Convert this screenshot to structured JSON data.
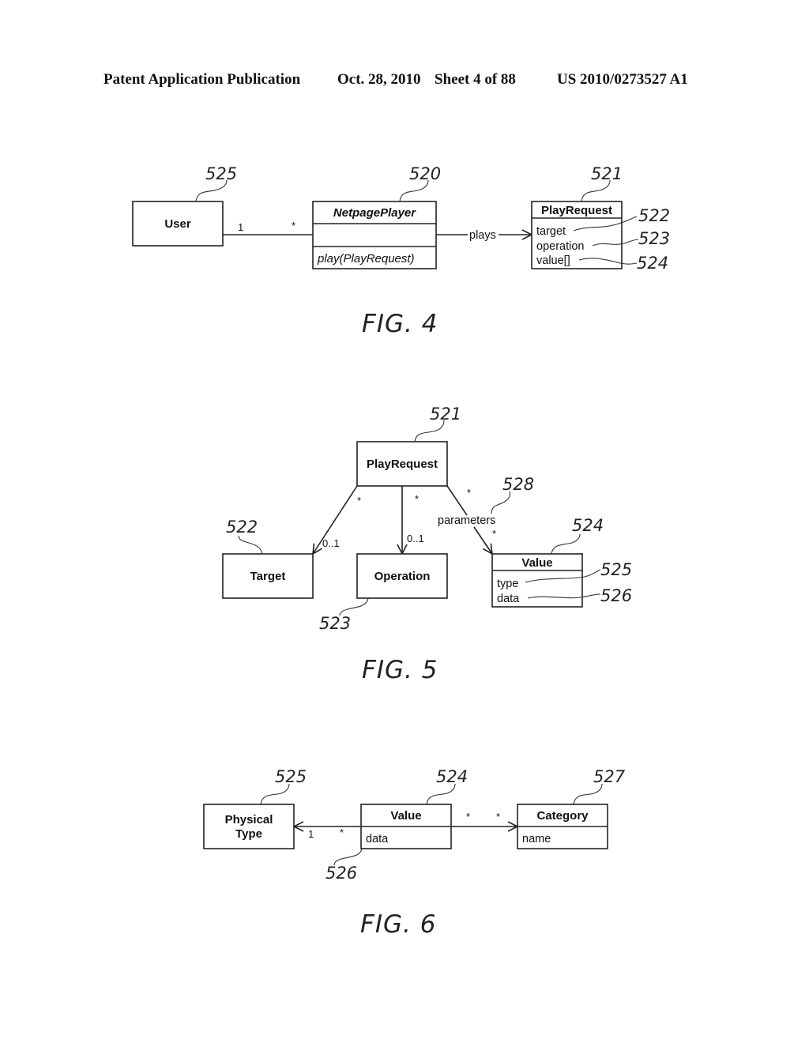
{
  "header": {
    "publication": "Patent Application Publication",
    "date": "Oct. 28, 2010",
    "sheet": "Sheet 4 of 88",
    "number": "US 2010/0273527 A1"
  },
  "fig4": {
    "caption": "FIG. 4",
    "user": {
      "name": "User",
      "ref": "525"
    },
    "player": {
      "name": "NetpagePlayer",
      "ref": "520",
      "method": "play(PlayRequest)"
    },
    "playrequest": {
      "name": "PlayRequest",
      "ref": "521",
      "attributes": [
        {
          "label": "target",
          "ref": "522"
        },
        {
          "label": "operation",
          "ref": "523"
        },
        {
          "label": "value[]",
          "ref": "524"
        }
      ]
    },
    "assoc_user_player": {
      "left_mult": "1",
      "right_mult": "*"
    },
    "assoc_plays": {
      "label": "plays"
    }
  },
  "fig5": {
    "caption": "FIG. 5",
    "playrequest": {
      "name": "PlayRequest",
      "ref": "521"
    },
    "target": {
      "name": "Target",
      "ref": "522"
    },
    "operation": {
      "name": "Operation",
      "ref": "523"
    },
    "value": {
      "name": "Value",
      "ref": "524",
      "attributes": [
        {
          "label": "type",
          "ref": "525"
        },
        {
          "label": "data",
          "ref": "526"
        }
      ]
    },
    "assoc_target": {
      "source_mult": "*",
      "target_mult": "0..1"
    },
    "assoc_operation": {
      "source_mult": "*",
      "target_mult": "0..1"
    },
    "assoc_parameters": {
      "label": "parameters",
      "ref": "528",
      "source_mult": "*",
      "target_mult": "*"
    }
  },
  "fig6": {
    "caption": "FIG. 6",
    "physical_type": {
      "name_line1": "Physical",
      "name_line2": "Type",
      "ref": "525"
    },
    "value": {
      "name": "Value",
      "ref": "524",
      "attribute": "data",
      "attribute_ref": "526"
    },
    "category": {
      "name": "Category",
      "ref": "527",
      "attribute": "name"
    },
    "assoc_type": {
      "target_mult": "1",
      "source_mult": "*"
    },
    "assoc_category": {
      "source_mult": "*",
      "target_mult": "*"
    }
  }
}
